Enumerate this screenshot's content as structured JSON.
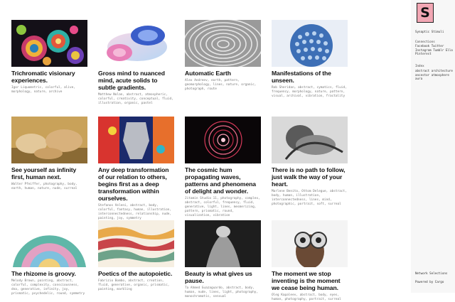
{
  "site": {
    "logo_letter": "S",
    "tagline": "Synaptic Stimuli",
    "connections_label": "Connections",
    "connections": "Facebook Twitter Instagram Tumblr Ello Pinterest",
    "index_label": "Index",
    "index_items": [
      "abstract architecture",
      "ancestor atmosphere",
      "aura"
    ],
    "footer_1": "Network Selections",
    "footer_2": "Powered by Cargo"
  },
  "cards": [
    {
      "title": "Trichromatic visionary experiences.",
      "tags": "Igor Liquometric, colorful, alive, morphology, nature, archive"
    },
    {
      "title": "Gross mind to nuanced mind, acute solids to subtle gradients.",
      "tags": "Matthew Nolan, abstract, atmospheric, colorful, creativity, conceptual, fluid, illustration, organic, pastel"
    },
    {
      "title": "Automatic Earth",
      "tags": "Alex Andreev, earth, pattern, geomorphology, lines, nature, organic, photograph, route"
    },
    {
      "title": "Manifestations of the unseen.",
      "tags": "Rob Sheridan, abstract, cymatics, fluid, frequency, morphology, nature, pattern, visual, archival, vibration, fractality"
    },
    {
      "title": "See yourself as infinity first, human next.",
      "tags": "Walter Pfeiffer, photography, body, earth, human, nature, nude, surreal"
    },
    {
      "title": "Any deep transformation of our relation to others, begins first as a deep transformation within ourselves.",
      "tags": "Stefanos Veleni, abstract, body, colorful, fantasy, human, illustration, interconnectedness, relationship, nude, painting, joy, symmetry"
    },
    {
      "title": "The cosmic hum propagating waves, patterns and phenomena of delight and wonder.",
      "tags": "Jitamin Studio 11, photography, complex, abstract, colorful, frequency, fluid, generative, light, lines, mesmerizing, pattern, prismatic, round, visualization, vibration"
    },
    {
      "title": "There is no path to follow, just walk the way of your heart.",
      "tags": "Marlene Benito, Ottom Delegue, abstract, body, human, illustration, interconnectedness, lines, mind, photographic, portrait, soft, surreal"
    },
    {
      "title": "The rhizome is groovy.",
      "tags": "Melody Brown, painting, abstract, colorful, complexity, consciousness, dna, generative, infinity, joy, prismatic, psychedelic, round, symmetry"
    },
    {
      "title": "Poetics of the autopoietic.",
      "tags": "Fabrizio Bombo, abstract, creation, fluid, generative, organic, prismatic, painting, marbling"
    },
    {
      "title": "Beauty is what gives us pause.",
      "tags": "Ta Ahmed Guazaguardo, abstract, body, human, nude, lines, light, photography, monochromatic, sensual"
    },
    {
      "title": "The moment we stop inventing is the moment we cease being human.",
      "tags": "Oleg Kapaleev, abstract, body, eyes, human, photography, portrait, surreal"
    }
  ]
}
